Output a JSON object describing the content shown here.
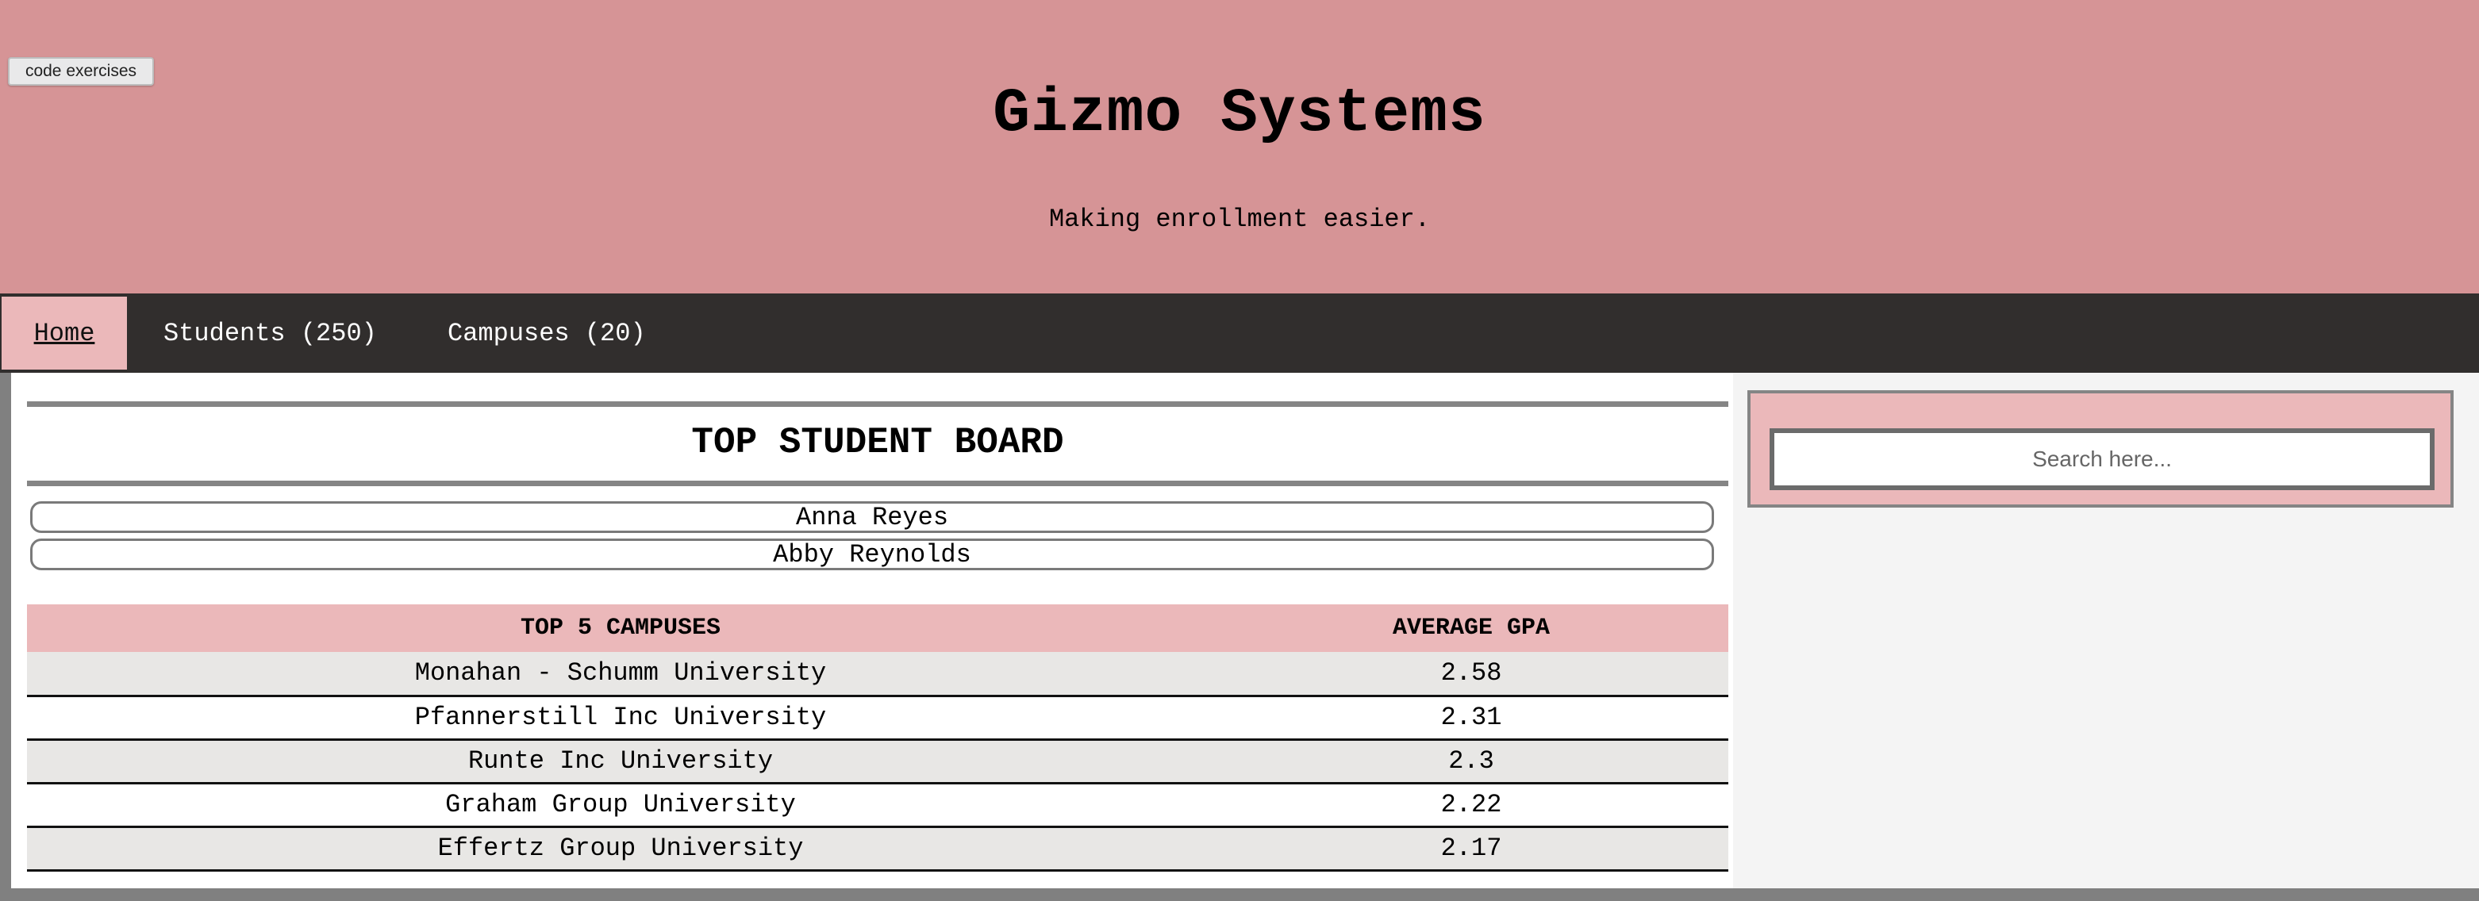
{
  "toolbar": {
    "code_button_label": "code exercises"
  },
  "header": {
    "title": "Gizmo Systems",
    "tagline": "Making enrollment easier."
  },
  "nav": {
    "items": [
      {
        "label": "Home",
        "active": true
      },
      {
        "label": "Students (250)",
        "active": false
      },
      {
        "label": "Campuses (20)",
        "active": false
      }
    ]
  },
  "board": {
    "title": "TOP STUDENT BOARD",
    "students": [
      "Anna Reyes",
      "Abby Reynolds"
    ]
  },
  "campus_table": {
    "headers": [
      "TOP 5 CAMPUSES",
      "AVERAGE GPA"
    ],
    "rows": [
      {
        "campus": "Monahan - Schumm University",
        "gpa": "2.58"
      },
      {
        "campus": "Pfannerstill Inc University",
        "gpa": "2.31"
      },
      {
        "campus": "Runte Inc University",
        "gpa": "2.3"
      },
      {
        "campus": "Graham Group University",
        "gpa": "2.22"
      },
      {
        "campus": "Effertz Group University",
        "gpa": "2.17"
      }
    ]
  },
  "search": {
    "placeholder": "Search here..."
  },
  "colors": {
    "header_bg": "#d69496",
    "nav_bg": "#312e2d",
    "accent_pink": "#ebb8ba",
    "row_alt": "#e8e7e5"
  }
}
